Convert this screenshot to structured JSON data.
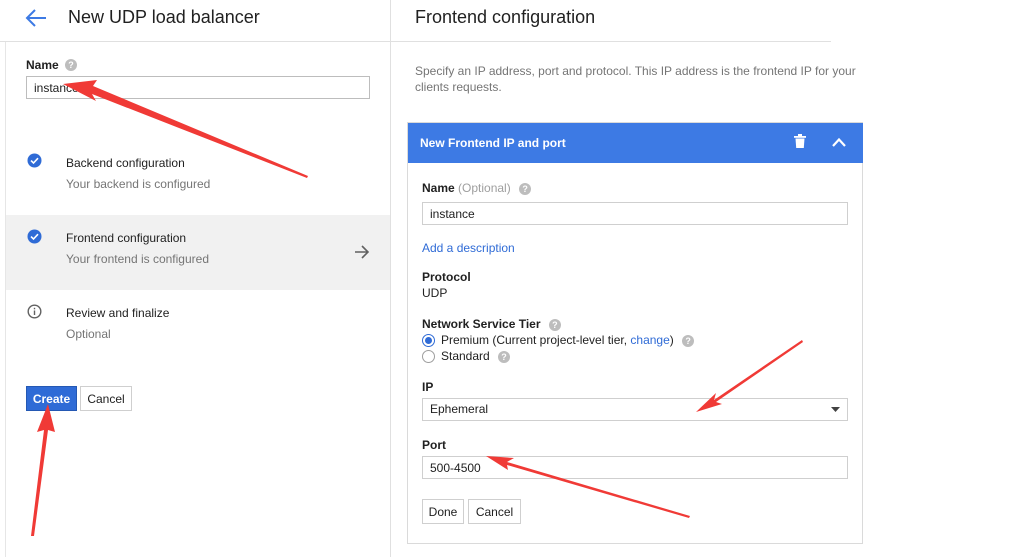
{
  "header": {
    "title": "New UDP load balancer"
  },
  "name_field": {
    "label": "Name",
    "value": "instance"
  },
  "steps": [
    {
      "title": "Backend configuration",
      "subtitle": "Your backend is configured",
      "status": "done"
    },
    {
      "title": "Frontend configuration",
      "subtitle": "Your frontend is configured",
      "status": "done"
    },
    {
      "title": "Review and finalize",
      "subtitle": "Optional",
      "status": "info"
    }
  ],
  "actions": {
    "create": "Create",
    "cancel": "Cancel"
  },
  "frontend": {
    "title": "Frontend configuration",
    "description": "Specify an IP address, port and protocol. This IP address is the frontend IP for your clients requests.",
    "card": {
      "title": "New Frontend IP and port",
      "name_label": "Name",
      "name_optional": "(Optional)",
      "name_value": "instance",
      "add_description": "Add a description",
      "protocol_label": "Protocol",
      "protocol_value": "UDP",
      "tier_label": "Network Service Tier",
      "tier_premium_prefix": "Premium (Current project-level tier, ",
      "tier_change_link": "change",
      "tier_premium_suffix": ")",
      "tier_standard": "Standard",
      "ip_label": "IP",
      "ip_value": "Ephemeral",
      "port_label": "Port",
      "port_value": "500-4500",
      "done": "Done",
      "cancel": "Cancel"
    }
  },
  "colors": {
    "accent": "#3d7ae4",
    "primary_button": "#2f6bd6",
    "annotation_arrow": "#f03a36"
  }
}
